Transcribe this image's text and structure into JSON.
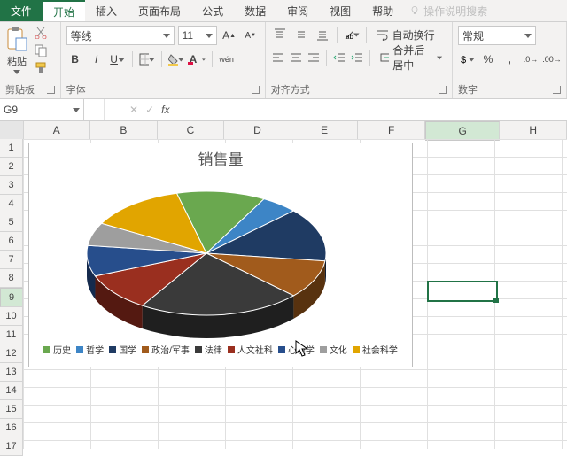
{
  "menu": {
    "file": "文件",
    "tabs": [
      "开始",
      "插入",
      "页面布局",
      "公式",
      "数据",
      "审阅",
      "视图",
      "帮助"
    ],
    "active_index": 0,
    "tell_me": "操作说明搜索"
  },
  "ribbon": {
    "clipboard": {
      "paste": "粘贴",
      "label": "剪贴板"
    },
    "font": {
      "name": "等线",
      "size": "11",
      "label": "字体"
    },
    "align": {
      "wrap": "自动换行",
      "merge": "合并后居中",
      "label": "对齐方式"
    },
    "number": {
      "format": "常规",
      "label": "数字"
    }
  },
  "formula_bar": {
    "cell_ref": "G9",
    "fx": "fx",
    "value": ""
  },
  "grid": {
    "cols": [
      "A",
      "B",
      "C",
      "D",
      "E",
      "F",
      "G",
      "H"
    ],
    "rows": [
      "1",
      "2",
      "3",
      "4",
      "5",
      "6",
      "7",
      "8",
      "9",
      "10",
      "11",
      "12",
      "13",
      "14",
      "15",
      "16",
      "17"
    ],
    "active": {
      "col_index": 6,
      "row_index": 8
    }
  },
  "chart_data": {
    "type": "pie",
    "title": "销售量",
    "series": [
      {
        "name": "历史",
        "value": 12,
        "color": "#6aa84f"
      },
      {
        "name": "哲学",
        "value": 5,
        "color": "#3d85c6"
      },
      {
        "name": "国学",
        "value": 14,
        "color": "#1f3b63"
      },
      {
        "name": "政治/军事",
        "value": 10,
        "color": "#a15b1c"
      },
      {
        "name": "法律",
        "value": 22,
        "color": "#3a3a3a"
      },
      {
        "name": "人文社科",
        "value": 10,
        "color": "#9a2f1f"
      },
      {
        "name": "心理学",
        "value": 8,
        "color": "#274e8c"
      },
      {
        "name": "文化",
        "value": 6,
        "color": "#9e9e9e"
      },
      {
        "name": "社会科学",
        "value": 13,
        "color": "#e1a500"
      }
    ]
  }
}
